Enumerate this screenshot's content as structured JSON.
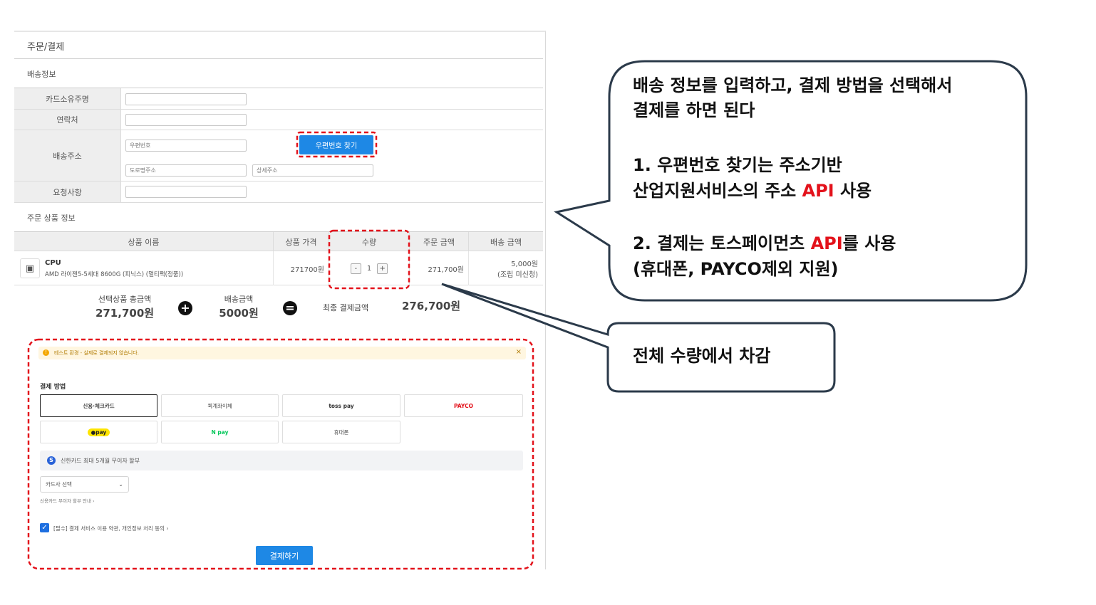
{
  "page": {
    "title": "주문/결제",
    "shipping_section": "배송정보",
    "product_section": "주문 상품 정보"
  },
  "form": {
    "card_owner_label": "카드소유주명",
    "contact_label": "연락처",
    "address_label": "배송주소",
    "zip_placeholder": "우편번호",
    "zip_button": "우편번호 찾기",
    "road_placeholder": "도로명주소",
    "detail_placeholder": "상세주소",
    "request_label": "요청사항"
  },
  "table": {
    "headers": [
      "상품 이름",
      "상품 가격",
      "수량",
      "주문 금액",
      "배송 금액"
    ],
    "row": {
      "name": "CPU",
      "desc": "AMD 라이젠5-5세대 8600G (피닉스) (멀티팩(정품))",
      "price": "271700원",
      "qty_minus": "-",
      "qty": "1",
      "qty_plus": "+",
      "order_amount": "271,700원",
      "ship_amount": "5,000원",
      "ship_note": "(조립 미신청)"
    }
  },
  "summary": {
    "items_label": "선택상품 총금액",
    "items_value": "271,700원",
    "plus": "+",
    "ship_label": "배송금액",
    "ship_value": "5000원",
    "equals": "=",
    "final_label": "최종 결제금액",
    "final_value": "276,700원"
  },
  "payment": {
    "notice": "테스트 환경 - 실제로 결제되지 않습니다.",
    "notice_icon": "!",
    "notice_close": "×",
    "title": "결제 방법",
    "options": [
      "신용·체크카드",
      "퀵계좌이체",
      "toss pay",
      "PAYCO",
      "●pay",
      "N pay",
      "휴대폰"
    ],
    "promo_icon": "S",
    "promo": "신한카드 최대 5개월 무이자 할부",
    "card_select": "카드사 선택",
    "card_select_arrow": "⌄",
    "installment_link": "신용카드 무이자 할부 안내 ›",
    "agree_check": "✓",
    "agree": "[필수] 결제 서비스 이용 약관, 개인정보 처리 동의 ›",
    "pay_button": "결제하기"
  },
  "callouts": {
    "main_line1": "배송 정보를 입력하고, 결제 방법을 선택해서",
    "main_line2": "결제를 하면 된다",
    "item1_line1": "1. 우편번호 찾기는 주소기반",
    "item1_line2_pre": "산업지원서비스의 주소 ",
    "item1_line2_api": "API",
    "item1_line2_post": " 사용",
    "item2_pre": "2. 결제는 토스페이먼츠 ",
    "item2_api": "API",
    "item2_post": "를 사용",
    "item2_line2": "(휴대폰, PAYCO제외 지원)",
    "qty_note": "전체 수량에서 차감"
  },
  "colors": {
    "accent_blue": "#1e88e5",
    "highlight_red": "#e3121b",
    "callout_border": "#2b3a4a"
  }
}
